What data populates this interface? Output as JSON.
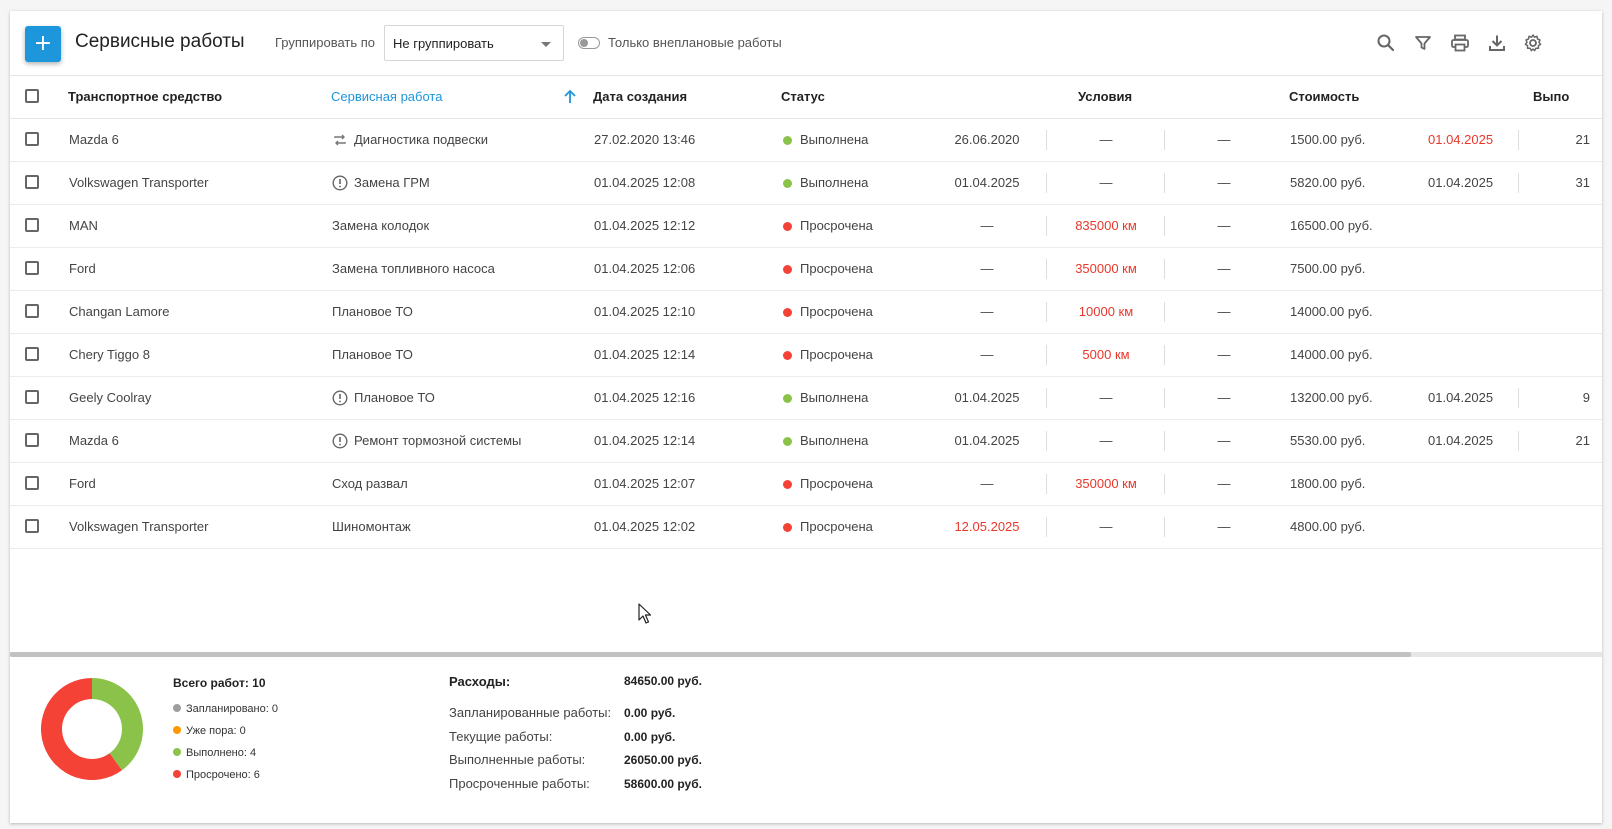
{
  "toolbar": {
    "add_label": "+",
    "title": "Сервисные работы",
    "group_label": "Группировать по",
    "group_value": "Не группировать",
    "toggle_label": "Только внеплановые работы"
  },
  "columns": {
    "vehicle": "Транспортное средство",
    "work": "Сервисная работа",
    "created": "Дата создания",
    "status": "Статус",
    "conditions": "Условия",
    "cost": "Стоимость",
    "done": "Выпо"
  },
  "colors": {
    "accent": "#1e96dc",
    "done": "#8bc34a",
    "overdue": "#f44336",
    "planned": "#9e9e9e",
    "due": "#ff9800"
  },
  "rows": [
    {
      "vehicle": "Mazda 6",
      "icon": "repeat-icon",
      "work": "Диагностика подвески",
      "created": "27.02.2020 13:46",
      "status": "Выполнена",
      "status_type": "done",
      "c1": "26.06.2020",
      "c1_red": false,
      "c2": "—",
      "c2_red": false,
      "c3": "—",
      "cost": "1500.00 руб.",
      "done_date": "01.04.2025",
      "done_red": true,
      "extra": "21"
    },
    {
      "vehicle": "Volkswagen Transporter",
      "icon": "alert-icon",
      "work": "Замена ГРМ",
      "created": "01.04.2025 12:08",
      "status": "Выполнена",
      "status_type": "done",
      "c1": "01.04.2025",
      "c1_red": false,
      "c2": "—",
      "c2_red": false,
      "c3": "—",
      "cost": "5820.00 руб.",
      "done_date": "01.04.2025",
      "done_red": false,
      "extra": "31"
    },
    {
      "vehicle": "MAN",
      "icon": "",
      "work": "Замена колодок",
      "created": "01.04.2025 12:12",
      "status": "Просрочена",
      "status_type": "overdue",
      "c1": "—",
      "c1_red": false,
      "c2": "835000 км",
      "c2_red": true,
      "c3": "—",
      "cost": "16500.00 руб.",
      "done_date": "",
      "done_red": false,
      "extra": ""
    },
    {
      "vehicle": "Ford",
      "icon": "",
      "work": "Замена топливного насоса",
      "created": "01.04.2025 12:06",
      "status": "Просрочена",
      "status_type": "overdue",
      "c1": "—",
      "c1_red": false,
      "c2": "350000 км",
      "c2_red": true,
      "c3": "—",
      "cost": "7500.00 руб.",
      "done_date": "",
      "done_red": false,
      "extra": ""
    },
    {
      "vehicle": "Changan Lamore",
      "icon": "",
      "work": "Плановое ТО",
      "created": "01.04.2025 12:10",
      "status": "Просрочена",
      "status_type": "overdue",
      "c1": "—",
      "c1_red": false,
      "c2": "10000 км",
      "c2_red": true,
      "c3": "—",
      "cost": "14000.00 руб.",
      "done_date": "",
      "done_red": false,
      "extra": ""
    },
    {
      "vehicle": "Chery Tiggo 8",
      "icon": "",
      "work": "Плановое ТО",
      "created": "01.04.2025 12:14",
      "status": "Просрочена",
      "status_type": "overdue",
      "c1": "—",
      "c1_red": false,
      "c2": "5000 км",
      "c2_red": true,
      "c3": "—",
      "cost": "14000.00 руб.",
      "done_date": "",
      "done_red": false,
      "extra": ""
    },
    {
      "vehicle": "Geely Coolray",
      "icon": "alert-icon",
      "work": "Плановое ТО",
      "created": "01.04.2025 12:16",
      "status": "Выполнена",
      "status_type": "done",
      "c1": "01.04.2025",
      "c1_red": false,
      "c2": "—",
      "c2_red": false,
      "c3": "—",
      "cost": "13200.00 руб.",
      "done_date": "01.04.2025",
      "done_red": false,
      "extra": "9"
    },
    {
      "vehicle": "Mazda 6",
      "icon": "alert-icon",
      "work": "Ремонт тормозной системы",
      "created": "01.04.2025 12:14",
      "status": "Выполнена",
      "status_type": "done",
      "c1": "01.04.2025",
      "c1_red": false,
      "c2": "—",
      "c2_red": false,
      "c3": "—",
      "cost": "5530.00 руб.",
      "done_date": "01.04.2025",
      "done_red": false,
      "extra": "21"
    },
    {
      "vehicle": "Ford",
      "icon": "",
      "work": "Сход развал",
      "created": "01.04.2025 12:07",
      "status": "Просрочена",
      "status_type": "overdue",
      "c1": "—",
      "c1_red": false,
      "c2": "350000 км",
      "c2_red": true,
      "c3": "—",
      "cost": "1800.00 руб.",
      "done_date": "",
      "done_red": false,
      "extra": ""
    },
    {
      "vehicle": "Volkswagen Transporter",
      "icon": "",
      "work": "Шиномонтаж",
      "created": "01.04.2025 12:02",
      "status": "Просрочена",
      "status_type": "overdue",
      "c1": "12.05.2025",
      "c1_red": true,
      "c2": "—",
      "c2_red": false,
      "c3": "—",
      "cost": "4800.00 руб.",
      "done_date": "",
      "done_red": false,
      "extra": ""
    }
  ],
  "summary": {
    "total": "Всего работ: 10",
    "legend": [
      {
        "label": "Запланировано: 0",
        "color": "#9e9e9e",
        "count": 0
      },
      {
        "label": "Уже пора: 0",
        "color": "#ff9800",
        "count": 0
      },
      {
        "label": "Выполнено: 4",
        "color": "#8bc34a",
        "count": 4
      },
      {
        "label": "Просрочено: 6",
        "color": "#f44336",
        "count": 6
      }
    ],
    "expenses_label": "Расходы:",
    "expenses_value": "84650.00 руб.",
    "lines": [
      {
        "label": "Запланированные работы:",
        "value": "0.00 руб."
      },
      {
        "label": "Текущие работы:",
        "value": "0.00 руб."
      },
      {
        "label": "Выполненные работы:",
        "value": "26050.00 руб."
      },
      {
        "label": "Просроченные работы:",
        "value": "58600.00 руб."
      }
    ]
  },
  "scroll_fraction": 0.88
}
